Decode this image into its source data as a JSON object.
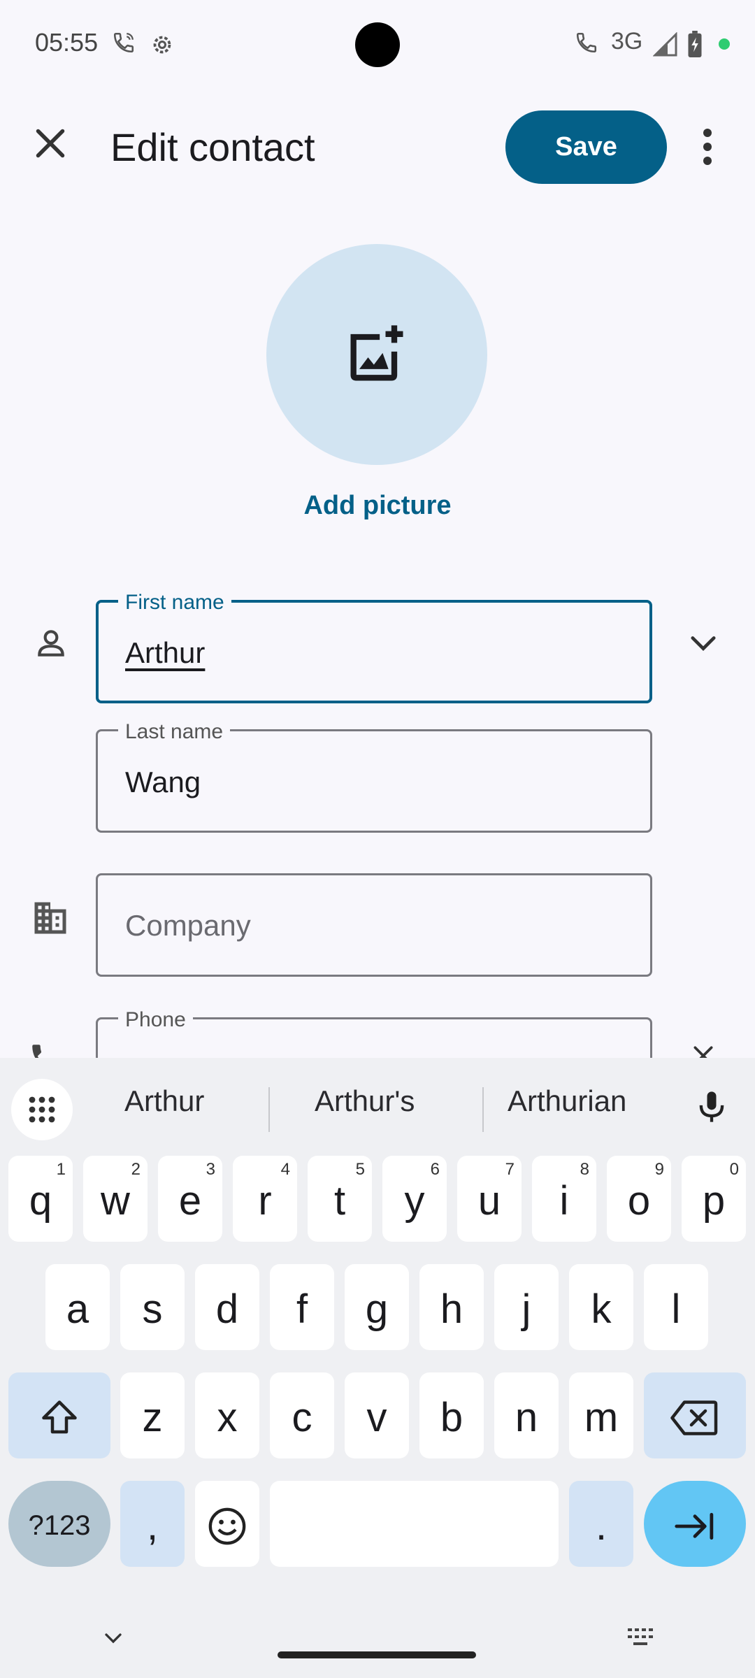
{
  "status_bar": {
    "time": "05:55",
    "network": "3G"
  },
  "toolbar": {
    "title": "Edit contact",
    "save_label": "Save"
  },
  "avatar": {
    "add_picture_label": "Add picture"
  },
  "fields": {
    "first_name": {
      "label": "First name",
      "value": "Arthur"
    },
    "last_name": {
      "label": "Last name",
      "value": "Wang"
    },
    "company": {
      "placeholder": "Company"
    },
    "phone": {
      "label": "Phone"
    }
  },
  "keyboard": {
    "suggestions": [
      "Arthur",
      "Arthur's",
      "Arthurian"
    ],
    "row1": [
      "q",
      "w",
      "e",
      "r",
      "t",
      "y",
      "u",
      "i",
      "o",
      "p"
    ],
    "row1_hints": [
      "1",
      "2",
      "3",
      "4",
      "5",
      "6",
      "7",
      "8",
      "9",
      "0"
    ],
    "row2": [
      "a",
      "s",
      "d",
      "f",
      "g",
      "h",
      "j",
      "k",
      "l"
    ],
    "row3": [
      "z",
      "x",
      "c",
      "v",
      "b",
      "n",
      "m"
    ],
    "sym_label": "?123",
    "comma": ",",
    "period": "."
  },
  "colors": {
    "accent": "#046088",
    "avatar_bg": "#d2e4f2",
    "enter_key": "#62c6f4"
  }
}
